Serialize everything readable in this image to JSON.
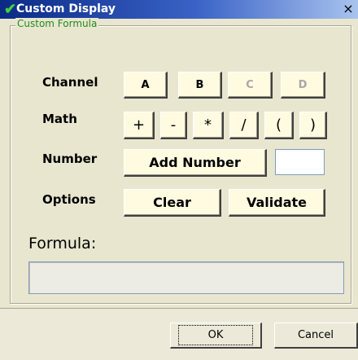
{
  "window": {
    "title": "Custom Display",
    "check_icon": "check-icon",
    "close_glyph": "×"
  },
  "group": {
    "title": "Custom Formula"
  },
  "rows": {
    "channel": {
      "label": "Channel",
      "buttons": [
        "A",
        "B",
        "C",
        "D"
      ],
      "enabled": [
        true,
        true,
        false,
        false
      ]
    },
    "math": {
      "label": "Math",
      "buttons": [
        "+",
        "-",
        "*",
        "/",
        "(",
        ")"
      ]
    },
    "number": {
      "label": "Number",
      "add_label": "Add Number",
      "input_value": ""
    },
    "options": {
      "label": "Options",
      "clear_label": "Clear",
      "validate_label": "Validate"
    }
  },
  "formula": {
    "label": "Formula:",
    "value": ""
  },
  "footer": {
    "ok_label": "OK",
    "cancel_label": "Cancel"
  },
  "colors": {
    "title_bar": "#0b2a86",
    "group_title": "#218a21",
    "button_face": "#fffbe0",
    "disabled_text": "#a7a7a7"
  }
}
